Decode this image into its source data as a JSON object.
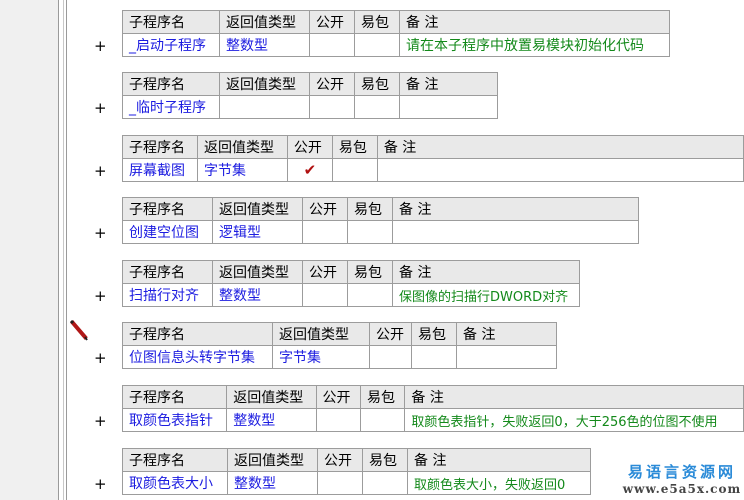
{
  "header": {
    "name": "子程序名",
    "rtype": "返回值类型",
    "public": "公开",
    "easy": "易包",
    "note": "备 注"
  },
  "expand_symbol": "+",
  "procedures": [
    {
      "name": "_启动子程序",
      "rtype": "整数型",
      "public": "",
      "easy": "",
      "note": "请在本子程序中放置易模块初始化代码"
    },
    {
      "name": "_临时子程序",
      "rtype": "",
      "public": "",
      "easy": "",
      "note": ""
    },
    {
      "name": "屏幕截图",
      "rtype": "字节集",
      "public": "✔",
      "easy": "",
      "note": ""
    },
    {
      "name": "创建空位图",
      "rtype": "逻辑型",
      "public": "",
      "easy": "",
      "note": ""
    },
    {
      "name": "扫描行对齐",
      "rtype": "整数型",
      "public": "",
      "easy": "",
      "note": "保图像的扫描行DWORD对齐"
    },
    {
      "name": "位图信息头转字节集",
      "rtype": "字节集",
      "public": "",
      "easy": "",
      "note": ""
    },
    {
      "name": "取颜色表指针",
      "rtype": "整数型",
      "public": "",
      "easy": "",
      "note": "取颜色表指针，失败返回0，大于256色的位图不使用"
    },
    {
      "name": "取颜色表大小",
      "rtype": "整数型",
      "public": "",
      "easy": "",
      "note": "取颜色表大小，失败返回0"
    }
  ],
  "watermark": {
    "line1": "易语言资源网",
    "line2": "www.e5a5x.com"
  },
  "icons": {
    "editor_marker": "pencil-icon"
  }
}
